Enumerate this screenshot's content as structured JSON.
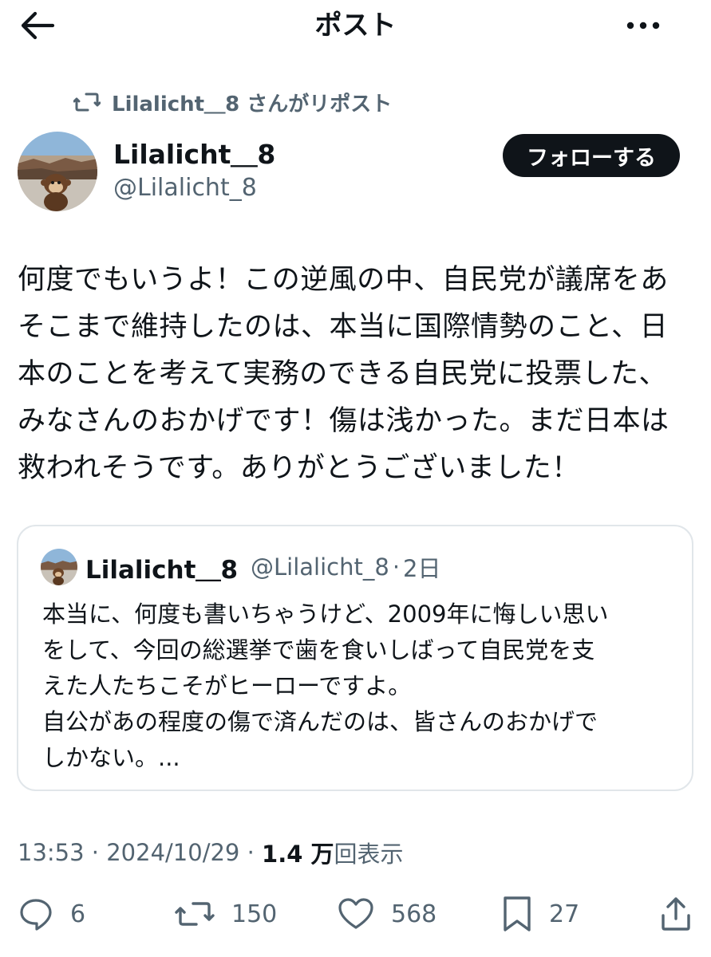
{
  "header": {
    "title": "ポスト"
  },
  "repost": {
    "label": "Lilalicht＿8 さんがリポスト"
  },
  "author": {
    "name": "Lilalicht＿8",
    "handle": "@Lilalicht_8",
    "follow_label": "フォローする"
  },
  "post": {
    "lines": [
      "何度でもいうよ！この逆風の中、自民党が議席をあ",
      "そこまで維持したのは、本当に国際情勢のこと、日",
      "本のことを考えて実務のできる自民党に投票した、",
      "みなさんのおかげです！傷は浅かった。まだ日本は",
      "救われそうです。ありがとうございました！"
    ]
  },
  "quote": {
    "name": "Lilalicht＿8",
    "handle": "@Lilalicht_8",
    "separator": "·",
    "time": "2日",
    "lines": [
      "本当に、何度も書いちゃうけど、2009年に悔しい思い",
      "をして、今回の総選挙で歯を食いしばって自民党を支",
      "えた人たちこそがヒーローですよ。",
      "自公があの程度の傷で済んだのは、皆さんのおかげで",
      "しかない。..."
    ]
  },
  "meta": {
    "time": "13:53",
    "separator": " · ",
    "date": "2024/10/29",
    "views_count": "1.4 万",
    "views_label": "回表示"
  },
  "actions": {
    "reply_count": "6",
    "repost_count": "150",
    "like_count": "568",
    "bookmark_count": "27"
  },
  "icons": {
    "back": "back-arrow-icon",
    "more": "more-dots-icon",
    "repost": "repost-icon",
    "reply": "reply-icon",
    "like": "heart-icon",
    "bookmark": "bookmark-icon",
    "share": "share-icon"
  }
}
